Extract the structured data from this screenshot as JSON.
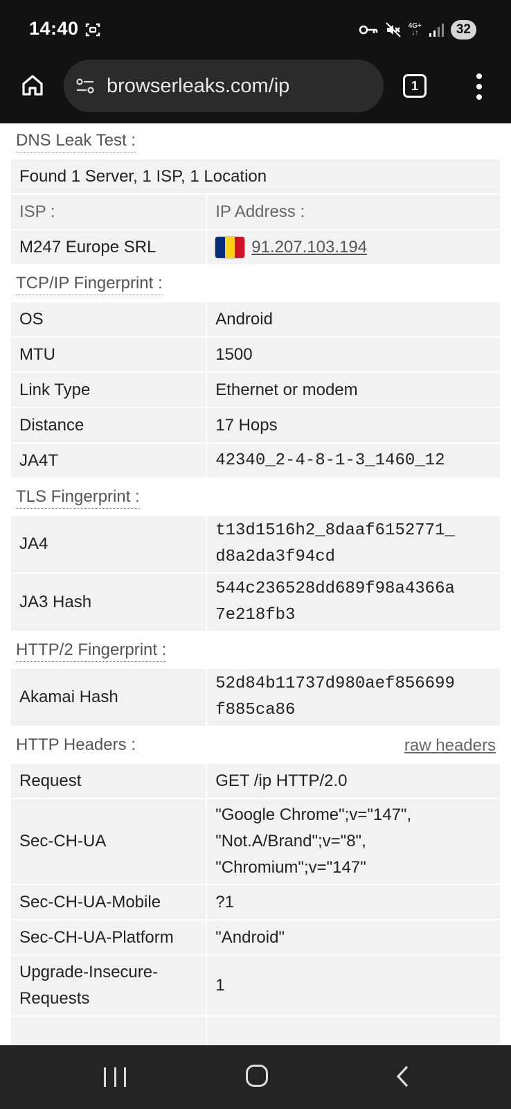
{
  "status_bar": {
    "time": "14:40",
    "network": "4G+",
    "battery": "32",
    "icons": [
      "screenshot-icon",
      "vpn-key-icon",
      "mute-icon",
      "signal-icon"
    ]
  },
  "browser": {
    "url": "browserleaks.com/ip",
    "tab_count": "1",
    "icons": [
      "home-icon",
      "site-info-icon",
      "tabs-icon",
      "more-vert-icon"
    ]
  },
  "dns": {
    "title": "DNS Leak Test :",
    "summary": "Found 1 Server, 1 ISP, 1 Location",
    "isp_header": "ISP :",
    "ip_header": "IP Address :",
    "isp_value": "M247 Europe SRL",
    "ip_value": "91.207.103.194",
    "flag_colors": [
      "#002b7f",
      "#fcd116",
      "#ce1126"
    ]
  },
  "tcp": {
    "title": "TCP/IP Fingerprint :",
    "rows": [
      {
        "label": "OS",
        "value": "Android"
      },
      {
        "label": "MTU",
        "value": "1500"
      },
      {
        "label": "Link Type",
        "value": "Ethernet or modem"
      },
      {
        "label": "Distance",
        "value": "17 Hops"
      },
      {
        "label": "JA4T",
        "value": "42340_2-4-8-1-3_1460_12"
      }
    ]
  },
  "tls": {
    "title": "TLS Fingerprint :",
    "rows": [
      {
        "label": "JA4",
        "line1": "t13d1516h2_8daaf6152771_",
        "line2": "d8a2da3f94cd"
      },
      {
        "label": "JA3 Hash",
        "line1": "544c236528dd689f98a4366a",
        "line2": "7e218fb3"
      }
    ]
  },
  "http2": {
    "title": "HTTP/2 Fingerprint :",
    "rows": [
      {
        "label": "Akamai Hash",
        "line1": "52d84b11737d980aef856699",
        "line2": "f885ca86"
      }
    ]
  },
  "headers": {
    "title": "HTTP Headers :",
    "raw_link": "raw headers",
    "request_label": "Request",
    "request_value": "GET /ip HTTP/2.0",
    "secchua_label": "Sec-CH-UA",
    "secchua_lines": [
      "\"Google Chrome\";v=\"147\",",
      "\"Not.A/Brand\";v=\"8\",",
      "\"Chromium\";v=\"147\""
    ],
    "mobile_label": "Sec-CH-UA-Mobile",
    "mobile_value": "?1",
    "platform_label": "Sec-CH-UA-Platform",
    "platform_value": "\"Android\"",
    "upgrade_label_1": "Upgrade-Insecure-",
    "upgrade_label_2": "Requests",
    "upgrade_value": "1"
  },
  "nav": {
    "icons": [
      "recents-icon",
      "home-nav-icon",
      "back-icon"
    ]
  }
}
